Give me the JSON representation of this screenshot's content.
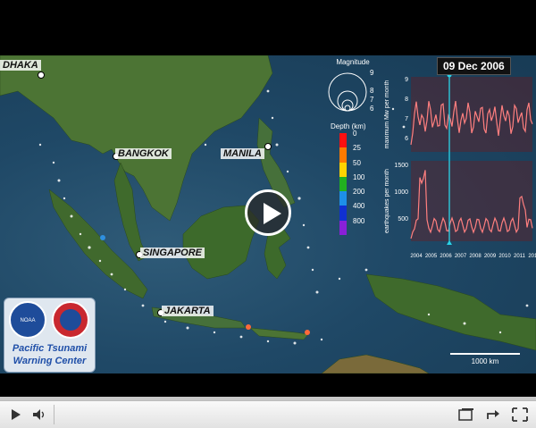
{
  "cities": [
    {
      "name": "DHAKA"
    },
    {
      "name": "BANGKOK"
    },
    {
      "name": "MANILA"
    },
    {
      "name": "SINGAPORE"
    },
    {
      "name": "JAKARTA"
    }
  ],
  "legend": {
    "magnitude_title": "Magnitude",
    "magnitude_values": [
      "9",
      "8",
      "7",
      "6"
    ],
    "depth_title": "Depth (km)",
    "depth_values": [
      "0",
      "25",
      "50",
      "100",
      "200",
      "400",
      "800"
    ],
    "depth_colors": [
      "#ff1010",
      "#ff7a00",
      "#ffd400",
      "#22b020",
      "#1d8fe8",
      "#1030d0",
      "#8a20d8"
    ]
  },
  "timeline": {
    "current_date": "09 Dec 2006",
    "top_ylabel": "maximum Mw per month",
    "top_ticks": [
      "9",
      "8",
      "7",
      "6"
    ],
    "bottom_ylabel": "earthquakes per month",
    "bottom_ticks": [
      "1500",
      "1000",
      "500"
    ],
    "x_ticks": [
      "2004",
      "2005",
      "2006",
      "2007",
      "2008",
      "2009",
      "2010",
      "2011",
      "2012"
    ]
  },
  "scale_bar": {
    "label": "1000 km"
  },
  "logo": {
    "line1": "Pacific Tsunami",
    "line2": "Warning Center"
  },
  "player": {
    "progress_fraction": 0.0
  }
}
